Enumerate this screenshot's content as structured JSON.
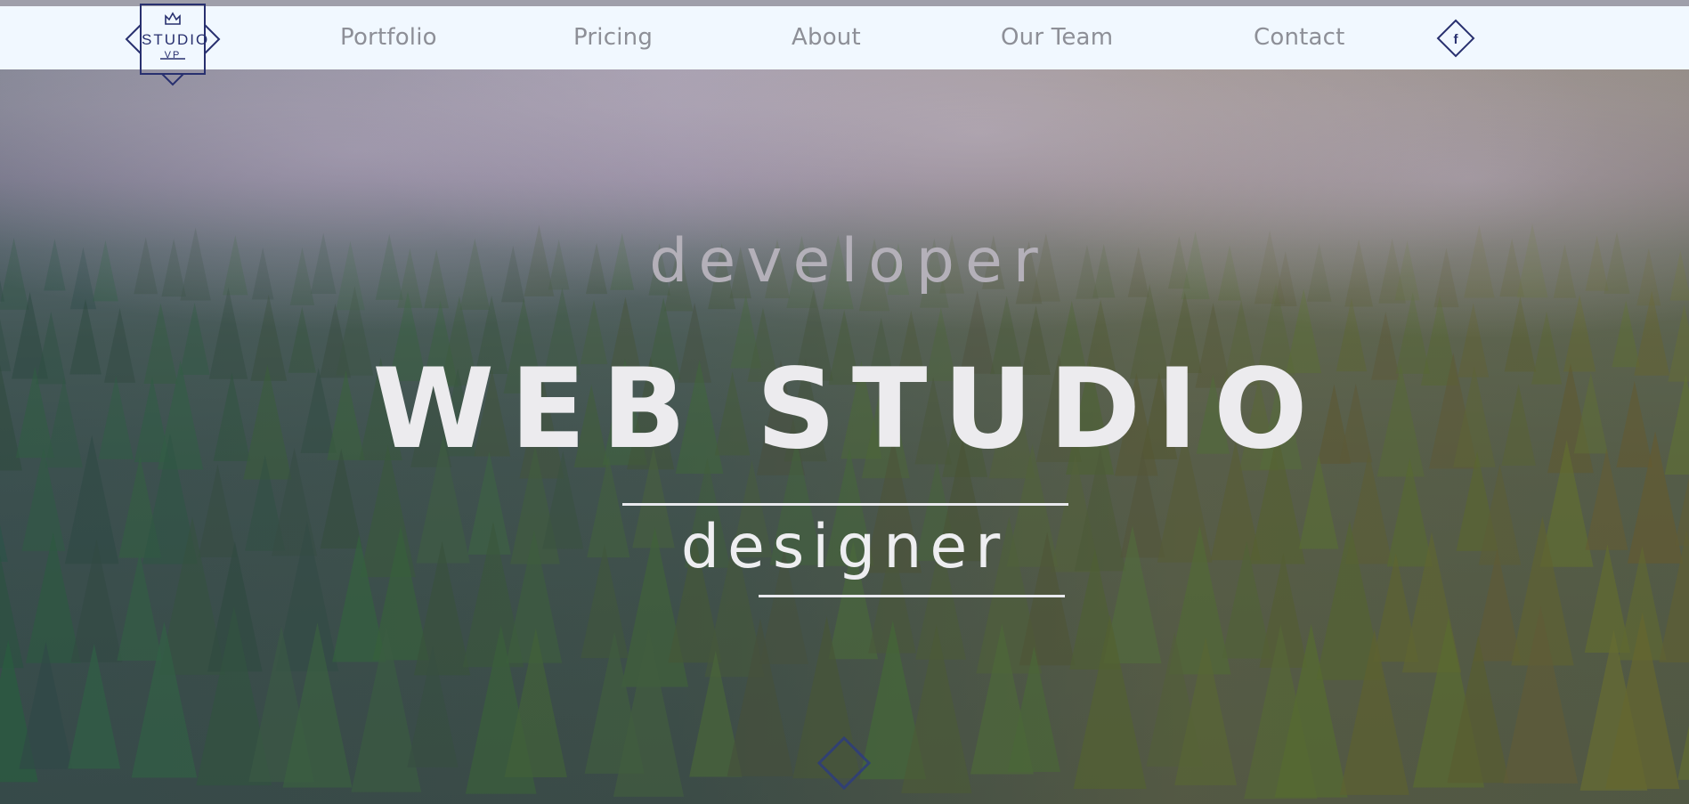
{
  "brand": {
    "logo_text": "STUDIO",
    "logo_subtext": "VP",
    "accent_color": "#28306f"
  },
  "nav": {
    "items": [
      {
        "label": "Portfolio"
      },
      {
        "label": "Pricing"
      },
      {
        "label": "About"
      },
      {
        "label": "Our Team"
      },
      {
        "label": "Contact"
      }
    ],
    "social_icon": "facebook-icon",
    "social_label": "f"
  },
  "hero": {
    "subtitle_top": "developer",
    "title": "WEB STUDIO",
    "subtitle_bottom": "designer",
    "scroll_icon": "diamond-scroll-icon"
  }
}
